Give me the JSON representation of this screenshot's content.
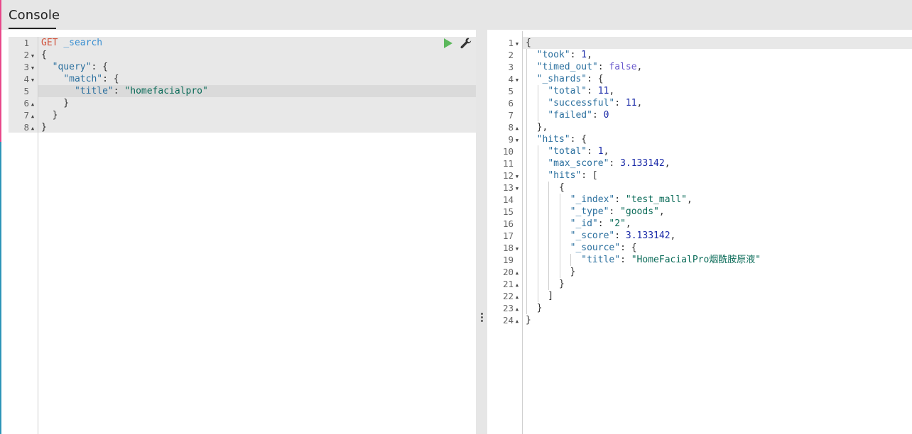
{
  "header": {
    "title": "Console"
  },
  "request": {
    "method": "GET",
    "path": "_search",
    "line_numbers": [
      "1",
      "2",
      "3",
      "4",
      "5",
      "6",
      "7",
      "8"
    ],
    "fold_markers": [
      "",
      "down",
      "down",
      "down",
      "",
      "up",
      "up",
      "up"
    ],
    "lines": [
      [
        {
          "t": "method",
          "v": "GET"
        },
        {
          "t": "punc",
          "v": " "
        },
        {
          "t": "path",
          "v": "_search"
        }
      ],
      [
        {
          "t": "punc",
          "v": "{"
        }
      ],
      [
        {
          "t": "punc",
          "v": "  "
        },
        {
          "t": "key",
          "v": "\"query\""
        },
        {
          "t": "punc",
          "v": ": {"
        }
      ],
      [
        {
          "t": "punc",
          "v": "    "
        },
        {
          "t": "key",
          "v": "\"match\""
        },
        {
          "t": "punc",
          "v": ": {"
        }
      ],
      [
        {
          "t": "punc",
          "v": "      "
        },
        {
          "t": "key",
          "v": "\"title\""
        },
        {
          "t": "punc",
          "v": ": "
        },
        {
          "t": "str",
          "v": "\"homefacialpro\""
        }
      ],
      [
        {
          "t": "punc",
          "v": "    }"
        }
      ],
      [
        {
          "t": "punc",
          "v": "  }"
        }
      ],
      [
        {
          "t": "punc",
          "v": "}"
        }
      ]
    ],
    "active_line": 5
  },
  "response": {
    "line_numbers": [
      "1",
      "2",
      "3",
      "4",
      "5",
      "6",
      "7",
      "8",
      "9",
      "10",
      "11",
      "12",
      "13",
      "14",
      "15",
      "16",
      "17",
      "18",
      "19",
      "20",
      "21",
      "22",
      "23",
      "24"
    ],
    "fold_markers": [
      "down",
      "",
      "",
      "down",
      "",
      "",
      "",
      "up",
      "down",
      "",
      "",
      "down",
      "down",
      "",
      "",
      "",
      "",
      "down",
      "",
      "up",
      "up",
      "up",
      "up",
      "up"
    ],
    "lines": [
      [
        {
          "t": "punc",
          "v": "{"
        }
      ],
      [
        {
          "t": "punc",
          "v": "  "
        },
        {
          "t": "key",
          "v": "\"took\""
        },
        {
          "t": "punc",
          "v": ": "
        },
        {
          "t": "num",
          "v": "1"
        },
        {
          "t": "punc",
          "v": ","
        }
      ],
      [
        {
          "t": "punc",
          "v": "  "
        },
        {
          "t": "key",
          "v": "\"timed_out\""
        },
        {
          "t": "punc",
          "v": ": "
        },
        {
          "t": "bool",
          "v": "false"
        },
        {
          "t": "punc",
          "v": ","
        }
      ],
      [
        {
          "t": "punc",
          "v": "  "
        },
        {
          "t": "key",
          "v": "\"_shards\""
        },
        {
          "t": "punc",
          "v": ": {"
        }
      ],
      [
        {
          "t": "punc",
          "v": "    "
        },
        {
          "t": "key",
          "v": "\"total\""
        },
        {
          "t": "punc",
          "v": ": "
        },
        {
          "t": "num",
          "v": "11"
        },
        {
          "t": "punc",
          "v": ","
        }
      ],
      [
        {
          "t": "punc",
          "v": "    "
        },
        {
          "t": "key",
          "v": "\"successful\""
        },
        {
          "t": "punc",
          "v": ": "
        },
        {
          "t": "num",
          "v": "11"
        },
        {
          "t": "punc",
          "v": ","
        }
      ],
      [
        {
          "t": "punc",
          "v": "    "
        },
        {
          "t": "key",
          "v": "\"failed\""
        },
        {
          "t": "punc",
          "v": ": "
        },
        {
          "t": "num",
          "v": "0"
        }
      ],
      [
        {
          "t": "punc",
          "v": "  },"
        }
      ],
      [
        {
          "t": "punc",
          "v": "  "
        },
        {
          "t": "key",
          "v": "\"hits\""
        },
        {
          "t": "punc",
          "v": ": {"
        }
      ],
      [
        {
          "t": "punc",
          "v": "    "
        },
        {
          "t": "key",
          "v": "\"total\""
        },
        {
          "t": "punc",
          "v": ": "
        },
        {
          "t": "num",
          "v": "1"
        },
        {
          "t": "punc",
          "v": ","
        }
      ],
      [
        {
          "t": "punc",
          "v": "    "
        },
        {
          "t": "key",
          "v": "\"max_score\""
        },
        {
          "t": "punc",
          "v": ": "
        },
        {
          "t": "num",
          "v": "3.133142"
        },
        {
          "t": "punc",
          "v": ","
        }
      ],
      [
        {
          "t": "punc",
          "v": "    "
        },
        {
          "t": "key",
          "v": "\"hits\""
        },
        {
          "t": "punc",
          "v": ": ["
        }
      ],
      [
        {
          "t": "punc",
          "v": "      {"
        }
      ],
      [
        {
          "t": "punc",
          "v": "        "
        },
        {
          "t": "key",
          "v": "\"_index\""
        },
        {
          "t": "punc",
          "v": ": "
        },
        {
          "t": "str",
          "v": "\"test_mall\""
        },
        {
          "t": "punc",
          "v": ","
        }
      ],
      [
        {
          "t": "punc",
          "v": "        "
        },
        {
          "t": "key",
          "v": "\"_type\""
        },
        {
          "t": "punc",
          "v": ": "
        },
        {
          "t": "str",
          "v": "\"goods\""
        },
        {
          "t": "punc",
          "v": ","
        }
      ],
      [
        {
          "t": "punc",
          "v": "        "
        },
        {
          "t": "key",
          "v": "\"_id\""
        },
        {
          "t": "punc",
          "v": ": "
        },
        {
          "t": "str",
          "v": "\"2\""
        },
        {
          "t": "punc",
          "v": ","
        }
      ],
      [
        {
          "t": "punc",
          "v": "        "
        },
        {
          "t": "key",
          "v": "\"_score\""
        },
        {
          "t": "punc",
          "v": ": "
        },
        {
          "t": "num",
          "v": "3.133142"
        },
        {
          "t": "punc",
          "v": ","
        }
      ],
      [
        {
          "t": "punc",
          "v": "        "
        },
        {
          "t": "key",
          "v": "\"_source\""
        },
        {
          "t": "punc",
          "v": ": {"
        }
      ],
      [
        {
          "t": "punc",
          "v": "          "
        },
        {
          "t": "key",
          "v": "\"title\""
        },
        {
          "t": "punc",
          "v": ": "
        },
        {
          "t": "str",
          "v": "\"HomeFacialPro烟酰胺原液\""
        }
      ],
      [
        {
          "t": "punc",
          "v": "        }"
        }
      ],
      [
        {
          "t": "punc",
          "v": "      }"
        }
      ],
      [
        {
          "t": "punc",
          "v": "    ]"
        }
      ],
      [
        {
          "t": "punc",
          "v": "  }"
        }
      ],
      [
        {
          "t": "punc",
          "v": "}"
        }
      ]
    ]
  },
  "colors": {
    "accent_run": "#5cb85c",
    "method": "#d0513a",
    "path": "#3a8fd1"
  },
  "icons": {
    "run": "play-icon",
    "settings": "wrench-icon",
    "resize": "vertical-dots-icon"
  }
}
